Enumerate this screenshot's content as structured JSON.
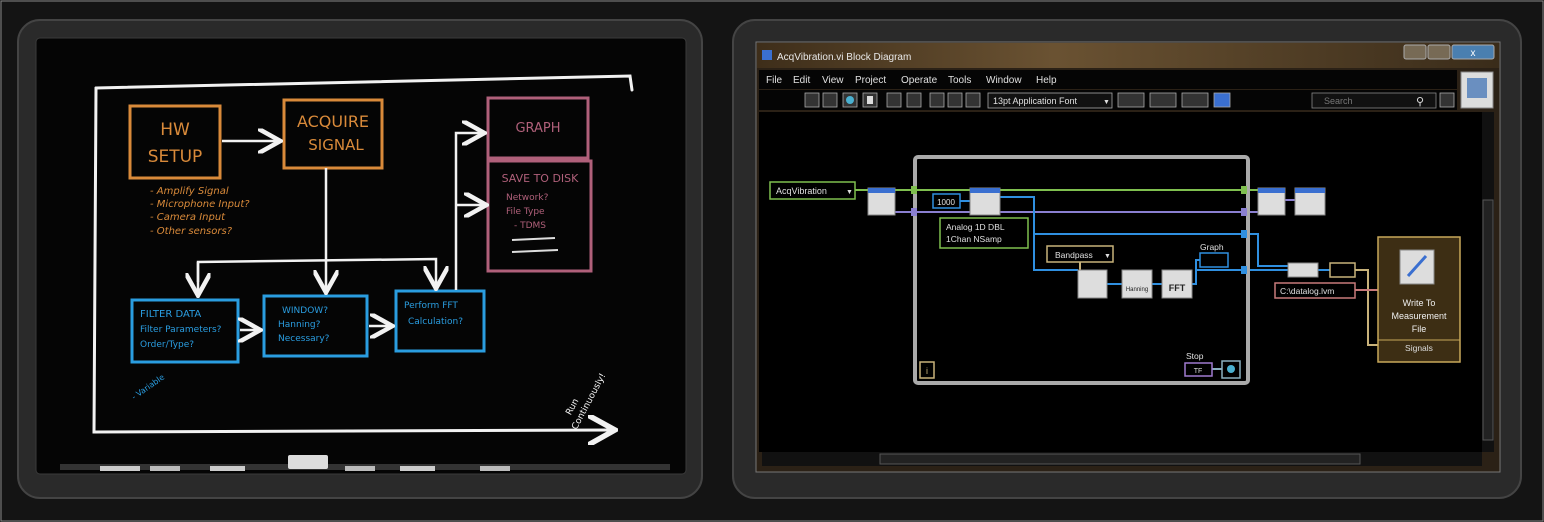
{
  "colors": {
    "orange_marker": "#d98a3a",
    "blue_marker": "#2a9de0",
    "pink_marker": "#b0607a",
    "chalk_white": "#f2f2f2",
    "wire_green": "#7fbf4f",
    "wire_purple": "#8a7fd0",
    "wire_blue": "#2f8fe0",
    "titlebar": "#5a4528"
  },
  "whiteboard": {
    "hw_setup": {
      "line1": "HW",
      "line2": "SETUP"
    },
    "hw_notes": [
      "- Amplify Signal",
      "- Microphone Input?",
      "- Camera Input",
      "- Other sensors?"
    ],
    "acquire": {
      "line1": "ACQUIRE",
      "line2": "SIGNAL"
    },
    "graph": "GRAPH",
    "save": {
      "title": "SAVE TO DISK",
      "notes": [
        "Network?",
        "File Type",
        "- TDMS"
      ]
    },
    "filter": [
      "FILTER DATA",
      "Filter Parameters?",
      "Order/Type?"
    ],
    "window": [
      "WINDOW?",
      "Hanning?",
      "Necessary?"
    ],
    "fft": [
      "Perform FFT",
      "Calculation?"
    ],
    "variable_note": "- Variable",
    "run_note": [
      "Run",
      "Continuously!"
    ]
  },
  "labview": {
    "title": "AcqVibration.vi Block Diagram",
    "menu": [
      "File",
      "Edit",
      "View",
      "Project",
      "Operate",
      "Tools",
      "Window",
      "Help"
    ],
    "font_select": "13pt Application Font",
    "search_placeholder": "Search",
    "icons": [
      "run-arrow-icon",
      "run-continuous-icon",
      "abort-icon",
      "pause-icon",
      "highlight-icon",
      "retain-wire-icon",
      "step-into-icon",
      "step-over-icon",
      "step-out-icon",
      "align-icon",
      "distribute-icon",
      "reorder-icon",
      "cleanup-icon",
      "search-icon",
      "help-icon"
    ],
    "diagram": {
      "task_constant": "AcqVibration",
      "samples_constant": "1000",
      "read_type": [
        "Analog 1D DBL",
        "1Chan NSamp"
      ],
      "filter_type": "Bandpass",
      "window_label": "Hanning",
      "fft_label": "FFT",
      "graph_label": "Graph",
      "stop_label": "Stop",
      "stop_value": "TF",
      "iteration_label": "i",
      "path_constant": "C:\\datalog.lvm",
      "write_vi": [
        "Write To",
        "Measurement",
        "File"
      ],
      "write_vi_terminal": "Signals"
    }
  }
}
